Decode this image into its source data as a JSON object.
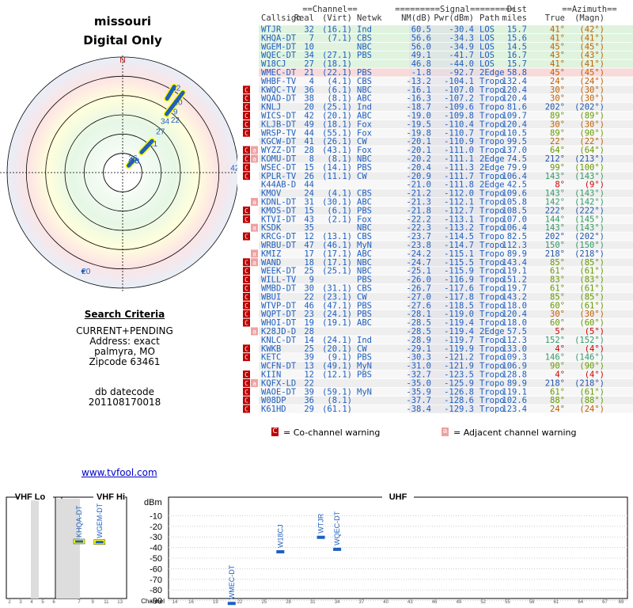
{
  "header": {
    "state": "missouri",
    "mode": "Digital Only"
  },
  "polar": {
    "north_label": "TrueNorth",
    "north_letter": "N",
    "labels": [
      {
        "text": "40",
        "az": 41,
        "dist": 15.6
      },
      {
        "text": "38",
        "az": 40,
        "dist": 15.3
      },
      {
        "text": "4",
        "az": 30,
        "dist": 14.4
      },
      {
        "text": "36",
        "az": 27,
        "dist": 17.1
      },
      {
        "text": "21",
        "az": 45,
        "dist": 48
      },
      {
        "text": "27",
        "az": 41,
        "dist": 66
      },
      {
        "text": "34",
        "az": 38,
        "dist": 80
      },
      {
        "text": "22",
        "az": 44,
        "dist": 90
      },
      {
        "text": "9",
        "az": 41,
        "dist": 100
      },
      {
        "text": "10",
        "az": 37,
        "dist": 110
      },
      {
        "text": "32",
        "az": 31,
        "dist": 124
      },
      {
        "text": "42",
        "az": 89,
        "dist": 140
      },
      {
        "text": "44",
        "az": 90,
        "dist": 149
      },
      {
        "text": "20",
        "az": 202,
        "dist": 142
      }
    ]
  },
  "criteria": {
    "heading": "Search Criteria",
    "lines": [
      "CURRENT+PENDING",
      "Address: exact",
      "palmyra, MO",
      "Zipcode 63461"
    ],
    "db_label": "db datecode",
    "db_value": "201108170018"
  },
  "link": "www.tvfool.com",
  "table": {
    "group_headers": {
      "channel": "==Channel==",
      "signal": "=========Signal=========",
      "dist": "Dist",
      "azimuth": "==Azimuth=="
    },
    "columns": {
      "callsign": "Callsign",
      "real": "Real",
      "virt": "(Virt)",
      "netwk": "Netwk",
      "nm": "NM(dB)",
      "pwr": "Pwr(dBm)",
      "path": "Path",
      "miles": "miles",
      "true": "True",
      "magn": "(Magn)"
    },
    "rows": [
      {
        "call": "WTJR",
        "real": "32",
        "virt": "(16.1)",
        "net": "Ind",
        "nm": "60.5",
        "pwr": "-30.4",
        "path": "LOS",
        "dist": "15.7",
        "az": "41°",
        "mag": "(42°)",
        "warn": "",
        "col": "g"
      },
      {
        "call": "KHQA-DT",
        "real": "7",
        "virt": "(7.1)",
        "net": "CBS",
        "nm": "56.6",
        "pwr": "-34.3",
        "path": "LOS",
        "dist": "15.6",
        "az": "41°",
        "mag": "(41°)",
        "warn": "",
        "col": "g"
      },
      {
        "call": "WGEM-DT",
        "real": "10",
        "virt": "",
        "net": "NBC",
        "nm": "56.0",
        "pwr": "-34.9",
        "path": "LOS",
        "dist": "14.5",
        "az": "45°",
        "mag": "(45°)",
        "warn": "",
        "col": "g"
      },
      {
        "call": "WQEC-DT",
        "real": "34",
        "virt": "(27.1)",
        "net": "PBS",
        "nm": "49.1",
        "pwr": "-41.7",
        "path": "LOS",
        "dist": "16.7",
        "az": "43°",
        "mag": "(43°)",
        "warn": "",
        "col": "g"
      },
      {
        "call": "W18CJ",
        "real": "27",
        "virt": "(18.1)",
        "net": "",
        "nm": "46.8",
        "pwr": "-44.0",
        "path": "LOS",
        "dist": "15.7",
        "az": "41°",
        "mag": "(41°)",
        "warn": "",
        "col": "g"
      },
      {
        "call": "WMEC-DT",
        "real": "21",
        "virt": "(22.1)",
        "net": "PBS",
        "nm": "-1.8",
        "pwr": "-92.7",
        "path": "2Edge",
        "dist": "58.8",
        "az": "45°",
        "mag": "(45°)",
        "warn": "",
        "col": "r"
      },
      {
        "call": "WHBF-TV",
        "real": "4",
        "virt": "(4.1)",
        "net": "CBS",
        "nm": "-13.2",
        "pwr": "-104.1",
        "path": "Tropo",
        "dist": "132.4",
        "az": "24°",
        "mag": "(24°)",
        "warn": "",
        "col": "n"
      },
      {
        "call": "KWQC-TV",
        "real": "36",
        "virt": "(6.1)",
        "net": "NBC",
        "nm": "-16.1",
        "pwr": "-107.0",
        "path": "Tropo",
        "dist": "120.4",
        "az": "30°",
        "mag": "(30°)",
        "warn": "C",
        "col": "n"
      },
      {
        "call": "WQAD-DT",
        "real": "38",
        "virt": "(8.1)",
        "net": "ABC",
        "nm": "-16.3",
        "pwr": "-107.2",
        "path": "Tropo",
        "dist": "120.4",
        "az": "30°",
        "mag": "(30°)",
        "warn": "C",
        "col": "n"
      },
      {
        "call": "KNLJ",
        "real": "20",
        "virt": "(25.1)",
        "net": "Ind",
        "nm": "-18.7",
        "pwr": "-109.6",
        "path": "Tropo",
        "dist": "81.6",
        "az": "202°",
        "mag": "(202°)",
        "warn": "C",
        "col": "n"
      },
      {
        "call": "WICS-DT",
        "real": "42",
        "virt": "(20.1)",
        "net": "ABC",
        "nm": "-19.0",
        "pwr": "-109.8",
        "path": "Tropo",
        "dist": "109.7",
        "az": "89°",
        "mag": "(89°)",
        "warn": "C",
        "col": "n"
      },
      {
        "call": "KLJB-DT",
        "real": "49",
        "virt": "(18.1)",
        "net": "Fox",
        "nm": "-19.5",
        "pwr": "-110.4",
        "path": "Tropo",
        "dist": "120.4",
        "az": "30°",
        "mag": "(30°)",
        "warn": "C",
        "col": "n"
      },
      {
        "call": "WRSP-TV",
        "real": "44",
        "virt": "(55.1)",
        "net": "Fox",
        "nm": "-19.8",
        "pwr": "-110.7",
        "path": "Tropo",
        "dist": "110.5",
        "az": "89°",
        "mag": "(90°)",
        "warn": "C",
        "col": "n"
      },
      {
        "call": "KGCW-DT",
        "real": "41",
        "virt": "(26.1)",
        "net": "CW",
        "nm": "-20.1",
        "pwr": "-110.9",
        "path": "Tropo",
        "dist": "99.5",
        "az": "22°",
        "mag": "(22°)",
        "warn": "",
        "col": "n"
      },
      {
        "call": "WYZZ-DT",
        "real": "28",
        "virt": "(43.1)",
        "net": "Fox",
        "nm": "-20.1",
        "pwr": "-111.0",
        "path": "Tropo",
        "dist": "137.0",
        "az": "64°",
        "mag": "(64°)",
        "warn": "CA",
        "col": "n"
      },
      {
        "call": "KOMU-DT",
        "real": "8",
        "virt": "(8.1)",
        "net": "NBC",
        "nm": "-20.2",
        "pwr": "-111.1",
        "path": "2Edge",
        "dist": "74.5",
        "az": "212°",
        "mag": "(213°)",
        "warn": "CA",
        "col": "n"
      },
      {
        "call": "WSEC-DT",
        "real": "15",
        "virt": "(14.1)",
        "net": "PBS",
        "nm": "-20.4",
        "pwr": "-111.3",
        "path": "2Edge",
        "dist": "79.9",
        "az": "99°",
        "mag": "(100°)",
        "warn": "C",
        "col": "n"
      },
      {
        "call": "KPLR-TV",
        "real": "26",
        "virt": "(11.1)",
        "net": "CW",
        "nm": "-20.9",
        "pwr": "-111.7",
        "path": "Tropo",
        "dist": "106.4",
        "az": "143°",
        "mag": "(143°)",
        "warn": "C",
        "col": "n"
      },
      {
        "call": "K44AB-D",
        "real": "44",
        "virt": "",
        "net": "",
        "nm": "-21.0",
        "pwr": "-111.8",
        "path": "2Edge",
        "dist": "42.5",
        "az": "8°",
        "mag": "(9°)",
        "warn": "",
        "col": "n"
      },
      {
        "call": "KMOV",
        "real": "24",
        "virt": "(4.1)",
        "net": "CBS",
        "nm": "-21.2",
        "pwr": "-112.0",
        "path": "Tropo",
        "dist": "109.6",
        "az": "143°",
        "mag": "(143°)",
        "warn": "",
        "col": "n"
      },
      {
        "call": "KDNL-DT",
        "real": "31",
        "virt": "(30.1)",
        "net": "ABC",
        "nm": "-21.3",
        "pwr": "-112.1",
        "path": "Tropo",
        "dist": "105.8",
        "az": "142°",
        "mag": "(142°)",
        "warn": "A",
        "col": "n"
      },
      {
        "call": "KMOS-DT",
        "real": "15",
        "virt": "(6.1)",
        "net": "PBS",
        "nm": "-21.8",
        "pwr": "-112.7",
        "path": "Tropo",
        "dist": "108.5",
        "az": "222°",
        "mag": "(222°)",
        "warn": "C",
        "col": "n"
      },
      {
        "call": "KTVI-DT",
        "real": "43",
        "virt": "(2.1)",
        "net": "Fox",
        "nm": "-22.2",
        "pwr": "-113.1",
        "path": "Tropo",
        "dist": "107.0",
        "az": "144°",
        "mag": "(145°)",
        "warn": "C",
        "col": "n"
      },
      {
        "call": "KSDK",
        "real": "35",
        "virt": "",
        "net": "NBC",
        "nm": "-22.3",
        "pwr": "-113.2",
        "path": "Tropo",
        "dist": "106.4",
        "az": "143°",
        "mag": "(143°)",
        "warn": "A",
        "col": "n"
      },
      {
        "call": "KRCG-DT",
        "real": "12",
        "virt": "(13.1)",
        "net": "CBS",
        "nm": "-23.7",
        "pwr": "-114.5",
        "path": "Tropo",
        "dist": "82.5",
        "az": "202°",
        "mag": "(202°)",
        "warn": "C",
        "col": "n"
      },
      {
        "call": "WRBU-DT",
        "real": "47",
        "virt": "(46.1)",
        "net": "MyN",
        "nm": "-23.8",
        "pwr": "-114.7",
        "path": "Tropo",
        "dist": "112.3",
        "az": "150°",
        "mag": "(150°)",
        "warn": "",
        "col": "n"
      },
      {
        "call": "KMIZ",
        "real": "17",
        "virt": "(17.1)",
        "net": "ABC",
        "nm": "-24.2",
        "pwr": "-115.1",
        "path": "Tropo",
        "dist": "89.9",
        "az": "218°",
        "mag": "(218°)",
        "warn": "A",
        "col": "n"
      },
      {
        "call": "WAND",
        "real": "18",
        "virt": "(17.1)",
        "net": "NBC",
        "nm": "-24.7",
        "pwr": "-115.5",
        "path": "Tropo",
        "dist": "143.4",
        "az": "85°",
        "mag": "(85°)",
        "warn": "CA",
        "col": "n"
      },
      {
        "call": "WEEK-DT",
        "real": "25",
        "virt": "(25.1)",
        "net": "NBC",
        "nm": "-25.1",
        "pwr": "-115.9",
        "path": "Tropo",
        "dist": "119.1",
        "az": "61°",
        "mag": "(61°)",
        "warn": "C",
        "col": "n"
      },
      {
        "call": "WILL-TV",
        "real": "9",
        "virt": "",
        "net": "PBS",
        "nm": "-26.0",
        "pwr": "-116.9",
        "path": "Tropo",
        "dist": "151.2",
        "az": "83°",
        "mag": "(83°)",
        "warn": "C",
        "col": "n"
      },
      {
        "call": "WMBD-DT",
        "real": "30",
        "virt": "(31.1)",
        "net": "CBS",
        "nm": "-26.7",
        "pwr": "-117.6",
        "path": "Tropo",
        "dist": "119.7",
        "az": "61°",
        "mag": "(61°)",
        "warn": "C",
        "col": "n"
      },
      {
        "call": "WBUI",
        "real": "22",
        "virt": "(23.1)",
        "net": "CW",
        "nm": "-27.0",
        "pwr": "-117.8",
        "path": "Tropo",
        "dist": "143.2",
        "az": "85°",
        "mag": "(85°)",
        "warn": "C",
        "col": "n"
      },
      {
        "call": "WTVP-DT",
        "real": "46",
        "virt": "(47.1)",
        "net": "PBS",
        "nm": "-27.6",
        "pwr": "-118.5",
        "path": "Tropo",
        "dist": "118.0",
        "az": "60°",
        "mag": "(61°)",
        "warn": "C",
        "col": "n"
      },
      {
        "call": "WQPT-DT",
        "real": "23",
        "virt": "(24.1)",
        "net": "PBS",
        "nm": "-28.1",
        "pwr": "-119.0",
        "path": "Tropo",
        "dist": "120.4",
        "az": "30°",
        "mag": "(30°)",
        "warn": "C",
        "col": "n"
      },
      {
        "call": "WHOI-DT",
        "real": "19",
        "virt": "(19.1)",
        "net": "ABC",
        "nm": "-28.5",
        "pwr": "-119.4",
        "path": "Tropo",
        "dist": "118.0",
        "az": "60°",
        "mag": "(60°)",
        "warn": "C",
        "col": "n"
      },
      {
        "call": "K28JD-D",
        "real": "28",
        "virt": "",
        "net": "",
        "nm": "-28.5",
        "pwr": "-119.4",
        "path": "2Edge",
        "dist": "57.5",
        "az": "5°",
        "mag": "(5°)",
        "warn": "A",
        "col": "n"
      },
      {
        "call": "KNLC-DT",
        "real": "14",
        "virt": "(24.1)",
        "net": "Ind",
        "nm": "-28.9",
        "pwr": "-119.7",
        "path": "Tropo",
        "dist": "112.3",
        "az": "152°",
        "mag": "(152°)",
        "warn": "",
        "col": "n"
      },
      {
        "call": "KWKB",
        "real": "25",
        "virt": "(20.1)",
        "net": "CW",
        "nm": "-29.1",
        "pwr": "-119.9",
        "path": "Tropo",
        "dist": "133.0",
        "az": "4°",
        "mag": "(4°)",
        "warn": "C",
        "col": "n"
      },
      {
        "call": "KETC",
        "real": "39",
        "virt": "(9.1)",
        "net": "PBS",
        "nm": "-30.3",
        "pwr": "-121.2",
        "path": "Tropo",
        "dist": "109.3",
        "az": "146°",
        "mag": "(146°)",
        "warn": "C",
        "col": "n"
      },
      {
        "call": "WCFN-DT",
        "real": "13",
        "virt": "(49.1)",
        "net": "MyN",
        "nm": "-31.0",
        "pwr": "-121.9",
        "path": "Tropo",
        "dist": "106.9",
        "az": "90°",
        "mag": "(90°)",
        "warn": "",
        "col": "n"
      },
      {
        "call": "KIIN",
        "real": "12",
        "virt": "(12.1)",
        "net": "PBS",
        "nm": "-32.7",
        "pwr": "-123.5",
        "path": "Tropo",
        "dist": "128.8",
        "az": "4°",
        "mag": "(4°)",
        "warn": "C",
        "col": "n"
      },
      {
        "call": "KQFX-LD",
        "real": "22",
        "virt": "",
        "net": "",
        "nm": "-35.0",
        "pwr": "-125.9",
        "path": "Tropo",
        "dist": "89.9",
        "az": "218°",
        "mag": "(218°)",
        "warn": "CA",
        "col": "n"
      },
      {
        "call": "WAOE-DT",
        "real": "39",
        "virt": "(59.1)",
        "net": "MyN",
        "nm": "-35.9",
        "pwr": "-126.8",
        "path": "Tropo",
        "dist": "119.1",
        "az": "61°",
        "mag": "(61°)",
        "warn": "C",
        "col": "n"
      },
      {
        "call": "W08DP",
        "real": "36",
        "virt": "(8.1)",
        "net": "",
        "nm": "-37.7",
        "pwr": "-128.6",
        "path": "Tropo",
        "dist": "102.6",
        "az": "88°",
        "mag": "(88°)",
        "warn": "C",
        "col": "n"
      },
      {
        "call": "K61HD",
        "real": "29",
        "virt": "(61.1)",
        "net": "",
        "nm": "-38.4",
        "pwr": "-129.3",
        "path": "Tropo",
        "dist": "123.4",
        "az": "24°",
        "mag": "(24°)",
        "warn": "C",
        "col": "n"
      }
    ]
  },
  "legend": {
    "co_symbol": "C",
    "co_text": "= Co-channel warning",
    "adj_symbol": "a",
    "adj_text": "= Adjacent channel warning"
  },
  "spectrum": {
    "vhf_lo": "VHF Lo",
    "vhf_hi": "VHF Hi",
    "uhf": "UHF",
    "unit": "dBm",
    "channel_label": "Channel",
    "db_ticks": [
      -10,
      -20,
      -30,
      -40,
      -50,
      -60,
      -70,
      -80,
      -90
    ],
    "lo_ticks": [
      2,
      3,
      4,
      5,
      6
    ],
    "hi_ticks": [
      7,
      9,
      11,
      13
    ],
    "uhf_ticks": [
      14,
      16,
      19,
      22,
      25,
      28,
      31,
      34,
      37,
      40,
      43,
      46,
      49,
      52,
      55,
      58,
      61,
      64,
      67,
      69
    ],
    "stations": [
      {
        "label": "KHQA-DT",
        "ch": 7,
        "dbm": -34.3,
        "color": "#ffff00"
      },
      {
        "label": "WGEM-DT",
        "ch": 10,
        "dbm": -34.9,
        "color": "#ffff00"
      },
      {
        "label": "WMEC-DT",
        "ch": 21,
        "dbm": -92.7,
        "color": "#1f5fbf"
      },
      {
        "label": "W18CJ",
        "ch": 27,
        "dbm": -44.0,
        "color": "#1f5fbf"
      },
      {
        "label": "WTJR",
        "ch": 32,
        "dbm": -30.4,
        "color": "#1f5fbf"
      },
      {
        "label": "WQEC-DT",
        "ch": 34,
        "dbm": -41.7,
        "color": "#1f5fbf"
      }
    ]
  },
  "colors": {
    "good": "#dff3df",
    "bad": "#f8dada",
    "link": "#0000cc",
    "text_blue": "#1f5fbf",
    "warn_red": "#c00000",
    "adj_pink": "#f0a0a0"
  }
}
